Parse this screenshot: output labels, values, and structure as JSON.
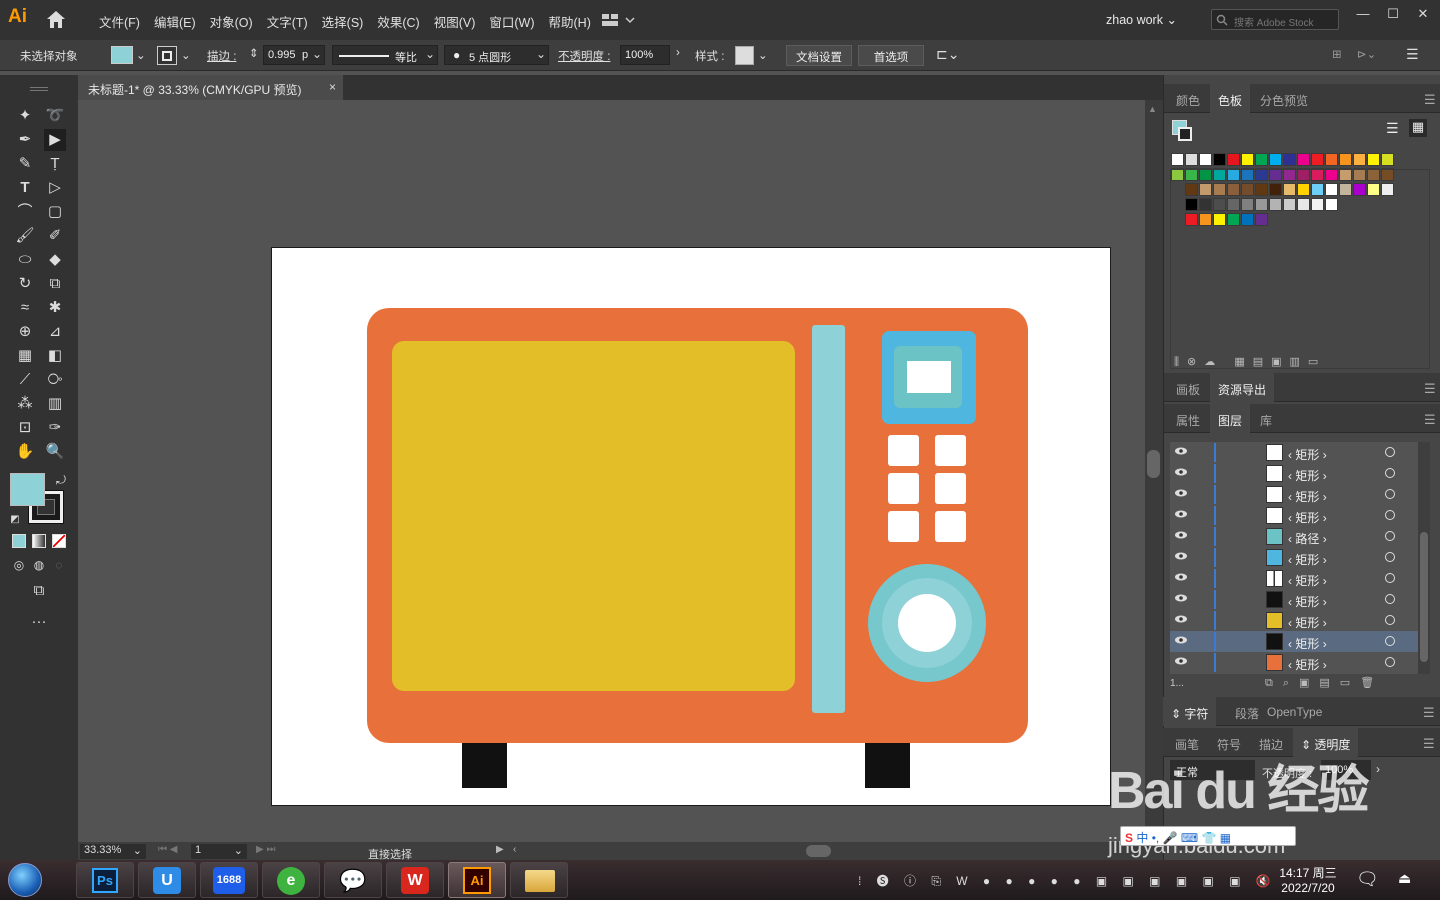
{
  "app": {
    "logo": "Ai",
    "user": "zhao work",
    "search_placeholder": "搜索 Adobe Stock"
  },
  "menu": [
    "文件(F)",
    "编辑(E)",
    "对象(O)",
    "文字(T)",
    "选择(S)",
    "效果(C)",
    "视图(V)",
    "窗口(W)",
    "帮助(H)"
  ],
  "control": {
    "selection": "未选择对象",
    "stroke_label": "描边 :",
    "stroke_value": "0.995",
    "stroke_unit": "p",
    "profile": "等比",
    "brush": "5 点圆形",
    "opacity_label": "不透明度 :",
    "opacity_value": "100%",
    "style_label": "样式 :",
    "doc_setup": "文档设置",
    "prefs": "首选项"
  },
  "doc_tab": {
    "title": "未标题-1* @ 33.33% (CMYK/GPU 预览)",
    "close": "×"
  },
  "status": {
    "zoom": "33.33%",
    "page": "1",
    "tool": "直接选择"
  },
  "panel1": {
    "tabs": [
      "颜色",
      "色板",
      "分色预览"
    ],
    "active": 1
  },
  "panel2": {
    "tabs": [
      "画板",
      "资源导出"
    ],
    "active": 1
  },
  "panel3": {
    "tabs": [
      "属性",
      "图层",
      "库"
    ],
    "active": 1
  },
  "layers": {
    "rows": [
      {
        "name": "矩形",
        "thumb": "#ffffff",
        "selected": false
      },
      {
        "name": "矩形",
        "thumb": "#ffffff",
        "selected": false
      },
      {
        "name": "矩形",
        "thumb": "#ffffff",
        "selected": false
      },
      {
        "name": "矩形",
        "thumb": "#ffffff",
        "selected": false
      },
      {
        "name": "路径",
        "thumb": "#6cc3c6",
        "selected": false
      },
      {
        "name": "矩形",
        "thumb": "#4fb6e0",
        "selected": false
      },
      {
        "name": "矩形",
        "thumb": "#ffffff",
        "selected": false
      },
      {
        "name": "矩形",
        "thumb": "#111111",
        "selected": false
      },
      {
        "name": "矩形",
        "thumb": "#e4be28",
        "selected": false
      },
      {
        "name": "矩形",
        "thumb": "#111111",
        "selected": true
      },
      {
        "name": "矩形",
        "thumb": "#e8703a",
        "selected": false
      }
    ],
    "count": "1..."
  },
  "panel4": {
    "tabs": [
      "字符",
      "段落",
      "OpenType"
    ],
    "active": 0
  },
  "panel5": {
    "tabs": [
      "画笔",
      "符号",
      "描边",
      "透明度"
    ],
    "active": 3
  },
  "transparency": {
    "mode": "正常",
    "opacity_label": "不透明度 :",
    "opacity_value": "100%"
  },
  "taskbar": {
    "time": "14:17 周三",
    "date": "2022/7/20",
    "apps": [
      "Ps",
      "U",
      "1688",
      "e",
      "微信",
      "W",
      "Ai",
      "文件夹"
    ]
  },
  "watermark": {
    "brand": "Bai du 经验",
    "url": "jingyan.baidu.com",
    "ime": "中"
  },
  "colors": {
    "fill": "#8ed1d6",
    "microwave_body": "#e8703a",
    "window": "#e4be28",
    "strip": "#8ed1d6",
    "display_bg": "#4fb6e0",
    "display_inner": "#6cc3c6",
    "knob_outer": "#76c8cd",
    "feet": "#111111"
  }
}
